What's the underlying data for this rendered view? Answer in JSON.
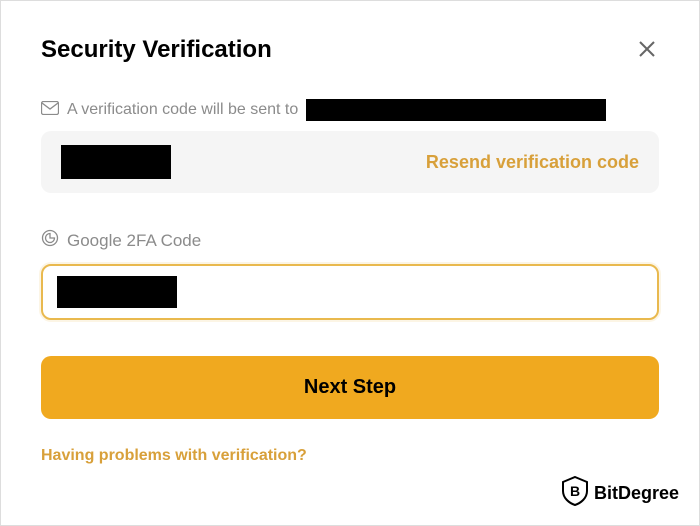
{
  "dialog": {
    "title": "Security Verification",
    "email_sent_label": "A verification code will be sent to",
    "resend_label": "Resend verification code",
    "google_2fa_label": "Google 2FA Code",
    "next_button_label": "Next Step",
    "problems_link": "Having problems with verification?"
  },
  "watermark": {
    "brand": "BitDegree"
  },
  "colors": {
    "accent": "#f0a91f",
    "link": "#d8a03a",
    "muted": "#8b8b8b"
  }
}
